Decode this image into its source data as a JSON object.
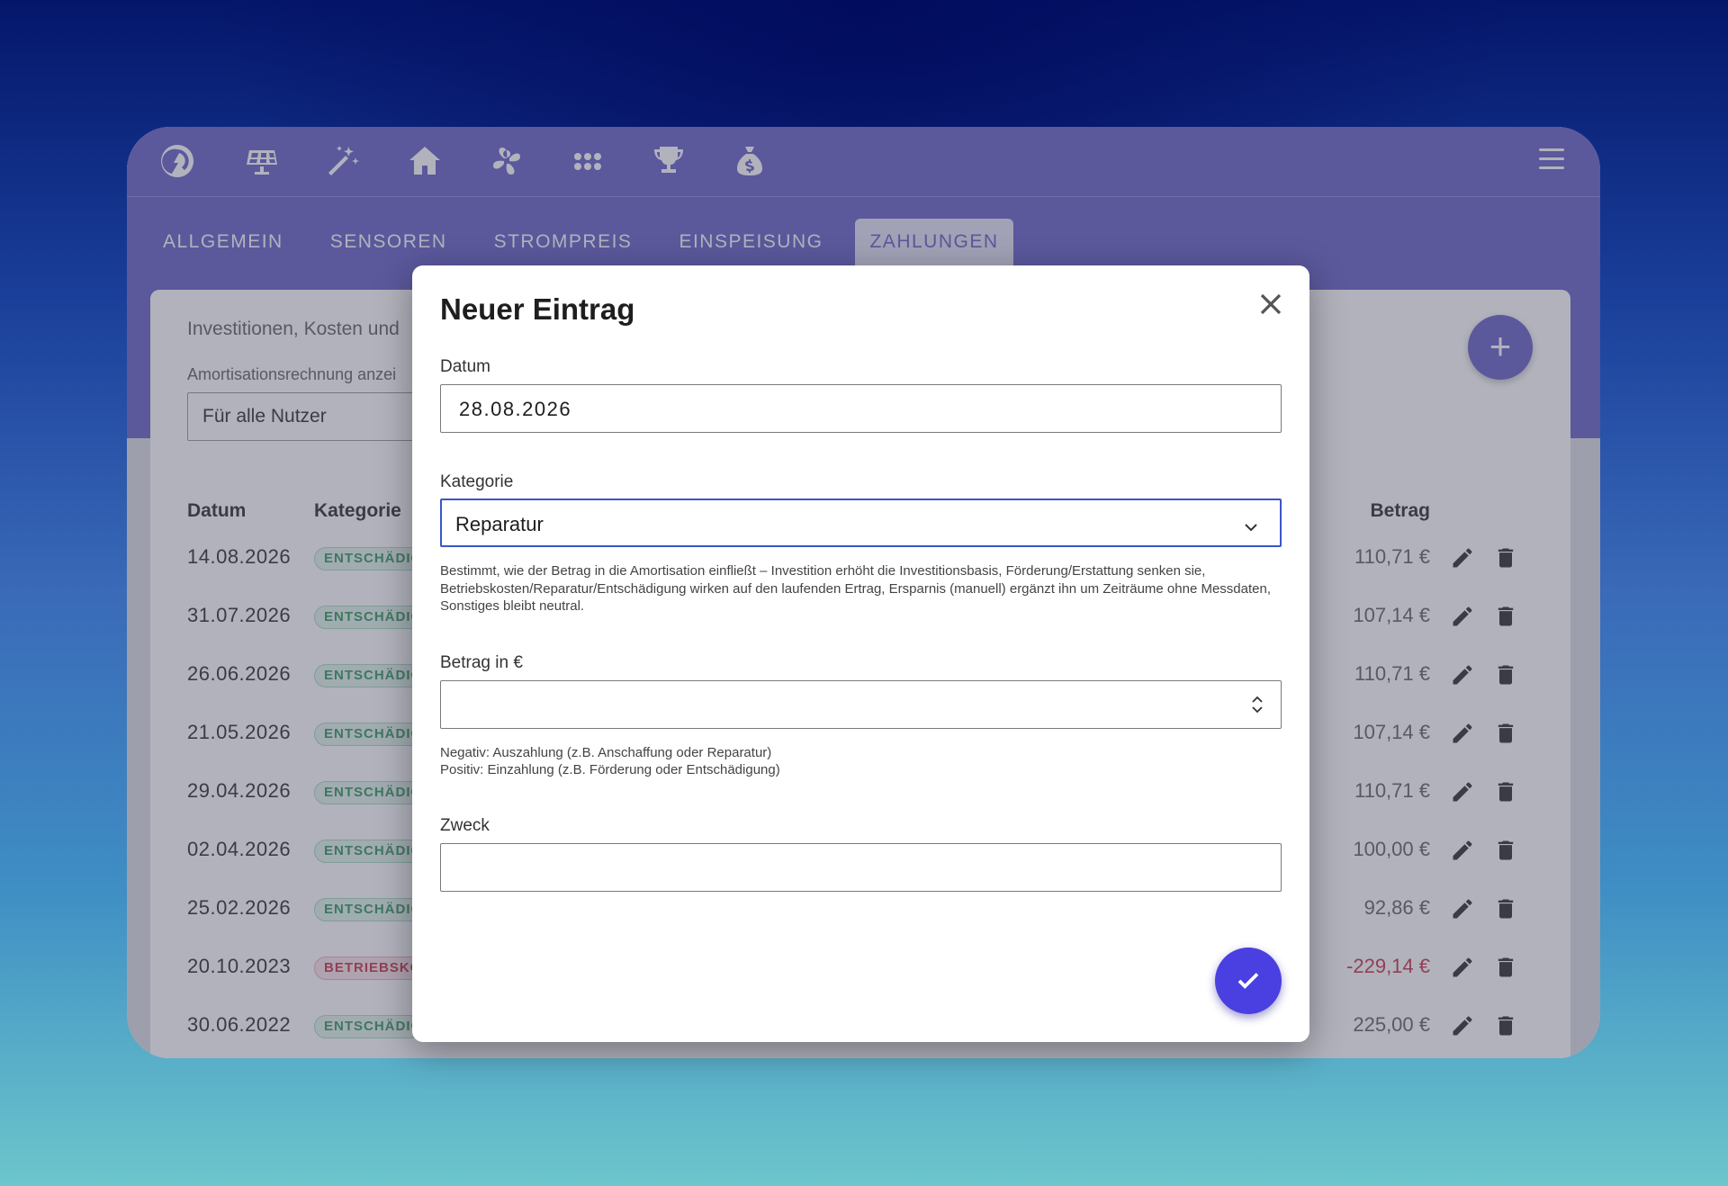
{
  "tabs": [
    {
      "label": "ALLGEMEIN"
    },
    {
      "label": "SENSOREN"
    },
    {
      "label": "STROMPREIS"
    },
    {
      "label": "EINSPEISUNG"
    },
    {
      "label": "ZAHLUNGEN"
    }
  ],
  "card": {
    "subtitle": "Investitionen, Kosten und",
    "amortization_label": "Amortisationsrechnung anzei",
    "user_select_value": "Für alle Nutzer",
    "add_label": "+"
  },
  "table": {
    "columns": {
      "date": "Datum",
      "category": "Kategorie",
      "amount": "Betrag"
    },
    "rows": [
      {
        "date": "14.08.2026",
        "category": "ENTSCHÄDIG",
        "amount": "110,71 €",
        "type": "green"
      },
      {
        "date": "31.07.2026",
        "category": "ENTSCHÄDIG",
        "amount": "107,14 €",
        "type": "green"
      },
      {
        "date": "26.06.2026",
        "category": "ENTSCHÄDIG",
        "amount": "110,71 €",
        "type": "green"
      },
      {
        "date": "21.05.2026",
        "category": "ENTSCHÄDIG",
        "amount": "107,14 €",
        "type": "green"
      },
      {
        "date": "29.04.2026",
        "category": "ENTSCHÄDIG",
        "amount": "110,71 €",
        "type": "green"
      },
      {
        "date": "02.04.2026",
        "category": "ENTSCHÄDIG",
        "amount": "100,00 €",
        "type": "green"
      },
      {
        "date": "25.02.2026",
        "category": "ENTSCHÄDIG",
        "amount": "92,86 €",
        "type": "green"
      },
      {
        "date": "20.10.2023",
        "category": "BETRIEBSKO",
        "amount": "-229,14 €",
        "type": "red"
      },
      {
        "date": "30.06.2022",
        "category": "ENTSCHÄDIG",
        "amount": "225,00 €",
        "type": "green"
      }
    ]
  },
  "dialog": {
    "title": "Neuer Eintrag",
    "date_label": "Datum",
    "date_value": "28.08.2026",
    "category_label": "Kategorie",
    "category_value": "Reparatur",
    "category_hint": "Bestimmt, wie der Betrag in die Amortisation einfließt – Investition erhöht die Investitionsbasis, Förderung/Erstattung senken sie, Betriebskosten/Reparatur/Entschädigung wirken auf den laufenden Ertrag, Ersparnis (manuell) ergänzt ihn um Zeiträume ohne Messdaten, Sonstiges bleibt neutral.",
    "amount_label": "Betrag in €",
    "amount_value": "",
    "amount_hint_1": "Negativ: Auszahlung (z.B. Anschaffung oder Reparatur)",
    "amount_hint_2": "Positiv: Einzahlung (z.B. Förderung oder Entschädigung)",
    "purpose_label": "Zweck",
    "purpose_value": ""
  },
  "colors": {
    "accent": "#6b64c8",
    "submit": "#4a3fe0",
    "focus_border": "#3b55c8",
    "chip_green": "#3a9a62",
    "chip_red": "#c93a50"
  },
  "icons": [
    "bolt-logo-icon",
    "solar-panel-icon",
    "magic-wand-icon",
    "home-icon",
    "fan-icon",
    "apps-grid-icon",
    "trophy-icon",
    "money-bag-icon",
    "menu-icon",
    "close-icon",
    "chevron-down-icon",
    "stepper-icon",
    "check-icon",
    "edit-icon",
    "delete-icon"
  ]
}
